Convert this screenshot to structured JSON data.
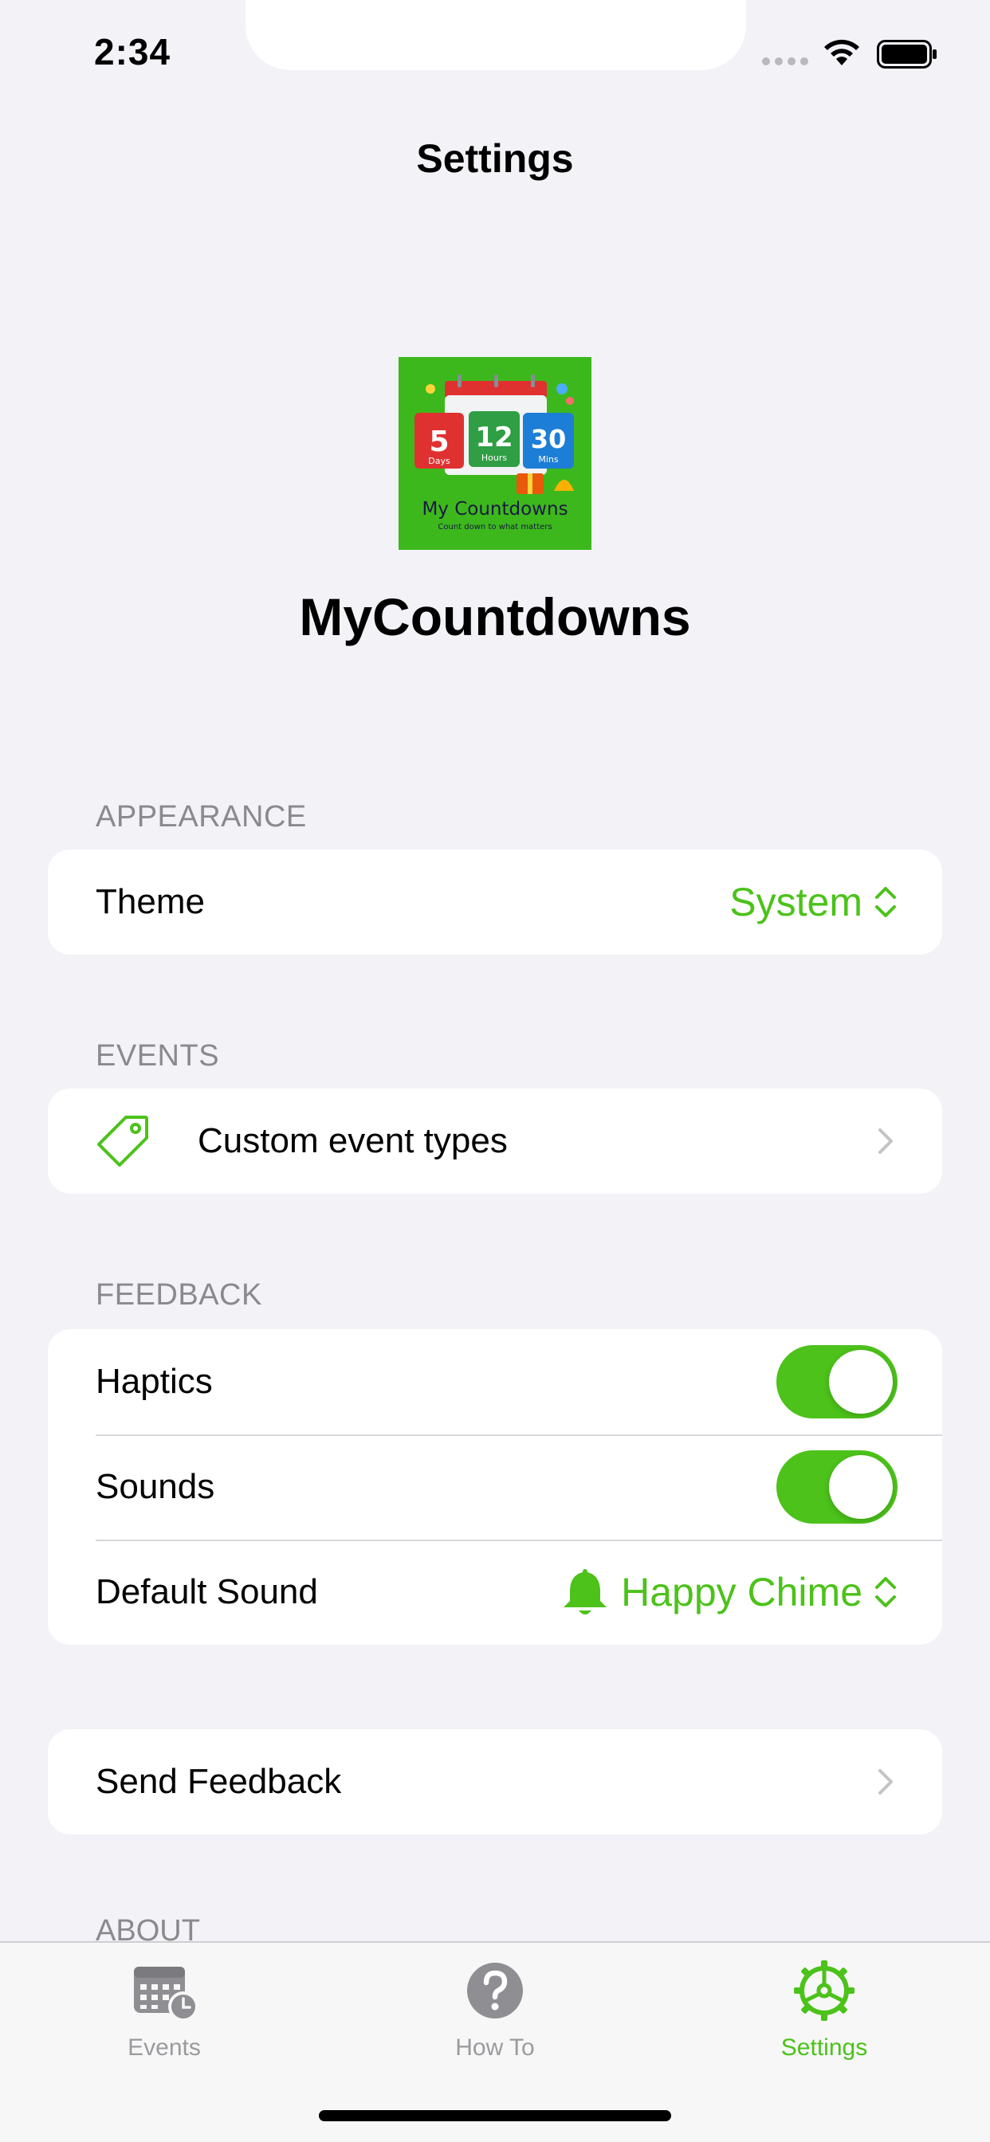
{
  "status_bar": {
    "time": "2:34"
  },
  "nav": {
    "title": "Settings"
  },
  "app": {
    "name": "MyCountdowns",
    "icon": {
      "days_num": "5",
      "days_label": "Days",
      "hours_num": "12",
      "hours_label": "Hours",
      "mins_num": "30",
      "mins_label": "Mins",
      "title": "My Countdowns",
      "tagline": "Count down to what matters"
    }
  },
  "appearance": {
    "header": "APPEARANCE",
    "theme_label": "Theme",
    "theme_value": "System"
  },
  "events": {
    "header": "EVENTS",
    "custom_types_label": "Custom event types",
    "icon": "tag-icon"
  },
  "feedback": {
    "header": "FEEDBACK",
    "haptics_label": "Haptics",
    "haptics_on": true,
    "sounds_label": "Sounds",
    "sounds_on": true,
    "default_sound_label": "Default Sound",
    "default_sound_value": "Happy Chime"
  },
  "send_feedback": {
    "label": "Send Feedback"
  },
  "about": {
    "header": "ABOUT"
  },
  "tabs": [
    {
      "label": "Events",
      "icon": "calendar-clock-icon",
      "active": false
    },
    {
      "label": "How To",
      "icon": "question-icon",
      "active": false
    },
    {
      "label": "Settings",
      "icon": "gear-icon",
      "active": true
    }
  ],
  "colors": {
    "accent": "#4cc21a",
    "background": "#f2f2f7",
    "secondary_text": "#8a8a8e"
  }
}
